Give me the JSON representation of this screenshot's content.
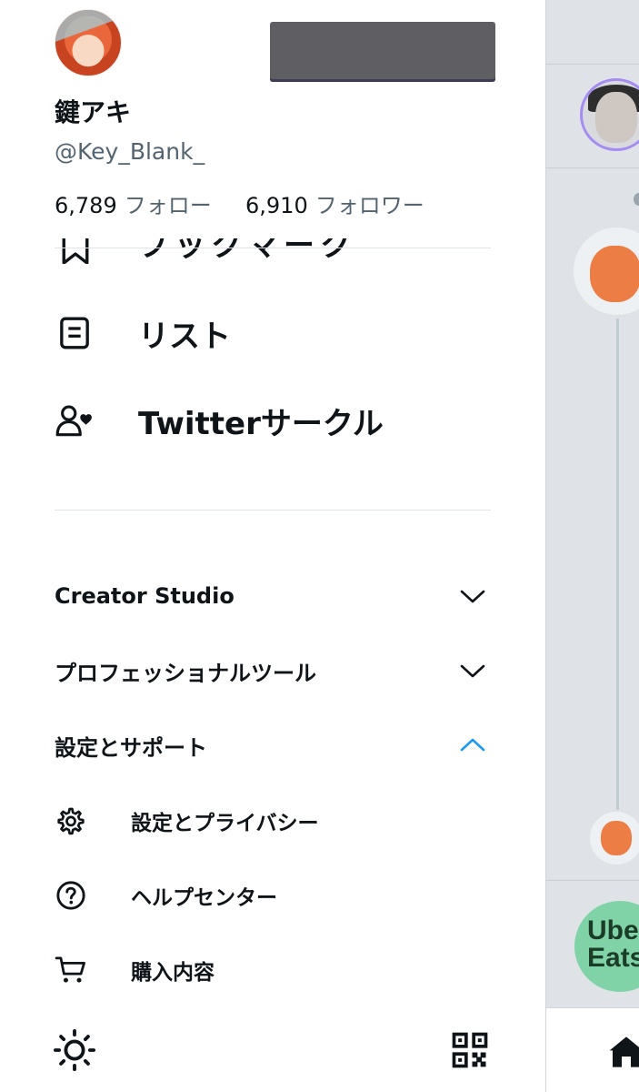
{
  "profile": {
    "display_name": "鍵アキ",
    "handle": "@Key_Blank_",
    "following_count": "6,789",
    "following_label": "フォロー",
    "followers_count": "6,910",
    "followers_label": "フォロワー"
  },
  "nav": {
    "bookmarks_partial_label": "ブックマーク",
    "lists_label": "リスト",
    "circle_label": "Twitterサークル"
  },
  "sections": {
    "creator_studio": "Creator Studio",
    "professional_tools": "プロフェッショナルツール",
    "settings_support": "設定とサポート"
  },
  "settings_menu": {
    "settings_privacy": "設定とプライバシー",
    "help_center": "ヘルプセンター",
    "purchases": "購入内容"
  },
  "background": {
    "uber_logo_line1": "Uber",
    "uber_logo_line2": "Eats"
  },
  "colors": {
    "accent": "#1d9bf0",
    "text_primary": "#0f1419",
    "text_secondary": "#536471"
  }
}
